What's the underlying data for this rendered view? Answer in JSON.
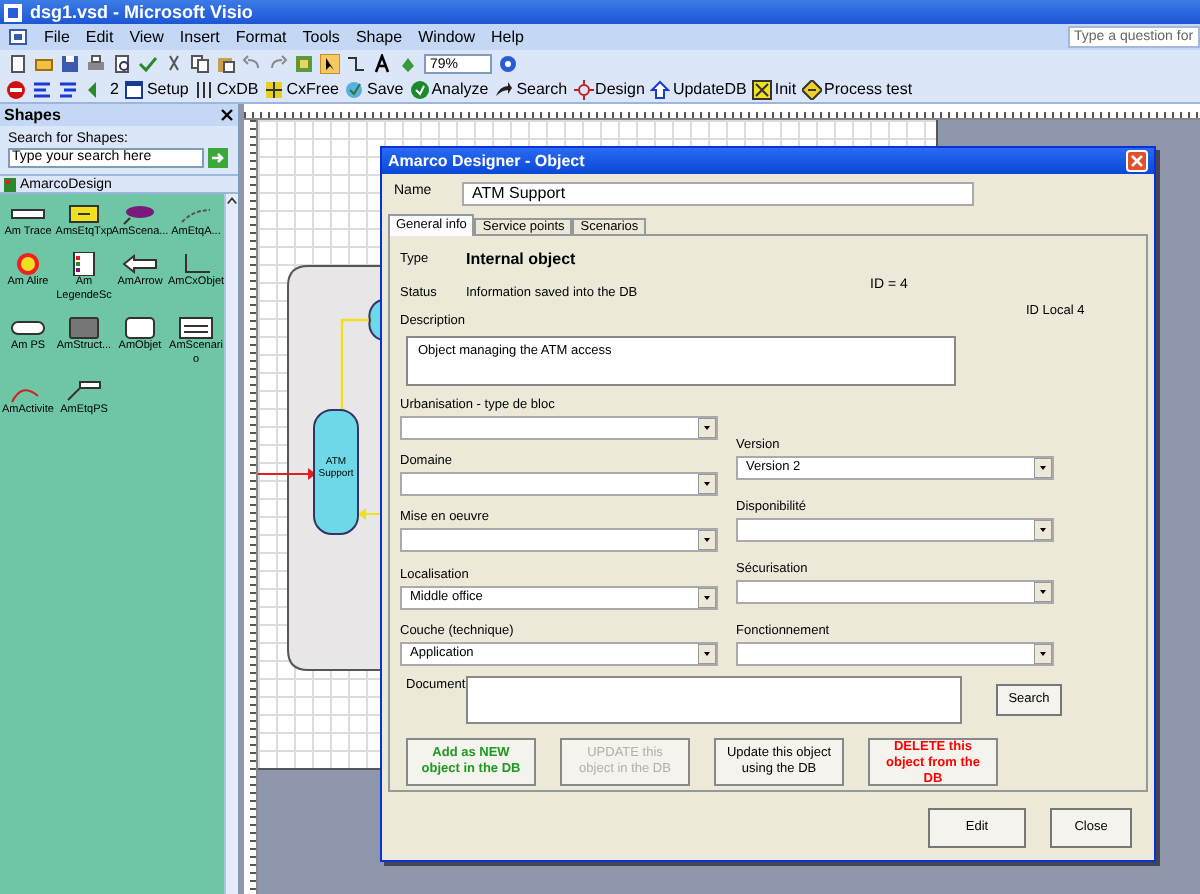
{
  "window": {
    "title": "dsg1.vsd - Microsoft Visio"
  },
  "menu": [
    "File",
    "Edit",
    "View",
    "Insert",
    "Format",
    "Tools",
    "Shape",
    "Window",
    "Help"
  ],
  "help_box": {
    "placeholder": "Type a question for"
  },
  "toolbar": {
    "zoom": "79%"
  },
  "custom_toolbar": [
    {
      "label": "2"
    },
    {
      "label": "Setup"
    },
    {
      "label": "CxDB"
    },
    {
      "label": "CxFree"
    },
    {
      "label": "Save"
    },
    {
      "label": "Analyze"
    },
    {
      "label": "Search"
    },
    {
      "label": "Design"
    },
    {
      "label": "UpdateDB"
    },
    {
      "label": "Init"
    },
    {
      "label": "Process test"
    }
  ],
  "shapes_panel": {
    "title": "Shapes",
    "search_label": "Search for Shapes:",
    "search_placeholder": "Type your search here",
    "stencil": "AmarcoDesign",
    "shapes": [
      {
        "label": "Am Trace"
      },
      {
        "label": "AmsEtqTxp"
      },
      {
        "label": "AmScena..."
      },
      {
        "label": "AmEtqA..."
      },
      {
        "label": "Am Alire"
      },
      {
        "label": "Am LegendeSc"
      },
      {
        "label": "AmArrow"
      },
      {
        "label": "AmCxObjet"
      },
      {
        "label": "Am PS"
      },
      {
        "label": "AmStruct..."
      },
      {
        "label": "AmObjet"
      },
      {
        "label": "AmScenario"
      },
      {
        "label": "AmActivite"
      },
      {
        "label": "AmEtqPS"
      }
    ]
  },
  "diagram": {
    "shape_label": "ATM Support"
  },
  "dialog": {
    "title": "Amarco Designer - Object",
    "name_label": "Name",
    "name_value": "ATM Support",
    "tabs": [
      {
        "label": "General info",
        "selected": true
      },
      {
        "label": "Service points",
        "selected": false
      },
      {
        "label": "Scenarios",
        "selected": false
      }
    ],
    "type_label": "Type",
    "type_value": "Internal object",
    "status_label": "Status",
    "status_value": "Information saved into the DB",
    "id": "ID = 4",
    "id_local": "ID Local 4",
    "description_label": "Description",
    "description": "Object managing the ATM access",
    "left_fields": [
      {
        "label": "Urbanisation - type de bloc"
      },
      {
        "label": "Domaine"
      },
      {
        "label": "Mise en oeuvre"
      },
      {
        "label": "Localisation",
        "value": "Middle office"
      },
      {
        "label": "Couche (technique)",
        "value": "Application"
      }
    ],
    "right_fields": [
      {
        "label": "Version",
        "value": "Version 2"
      },
      {
        "label": "Disponibilité"
      },
      {
        "label": "Sécurisation"
      },
      {
        "label": "Fonctionnement"
      }
    ],
    "document_label": "Document",
    "search_button": "Search",
    "actions": [
      {
        "label": "Add as NEW object in the DB",
        "color": "#1e9a1e",
        "disabled": false
      },
      {
        "label": "UPDATE this object in the DB",
        "disabled": true
      },
      {
        "label": "Update this object using the DB",
        "color": "#000000",
        "disabled": false
      },
      {
        "label": "DELETE this object from the DB",
        "color": "#ff0000",
        "disabled": false
      }
    ],
    "buttons": [
      "Edit",
      "Close"
    ]
  }
}
